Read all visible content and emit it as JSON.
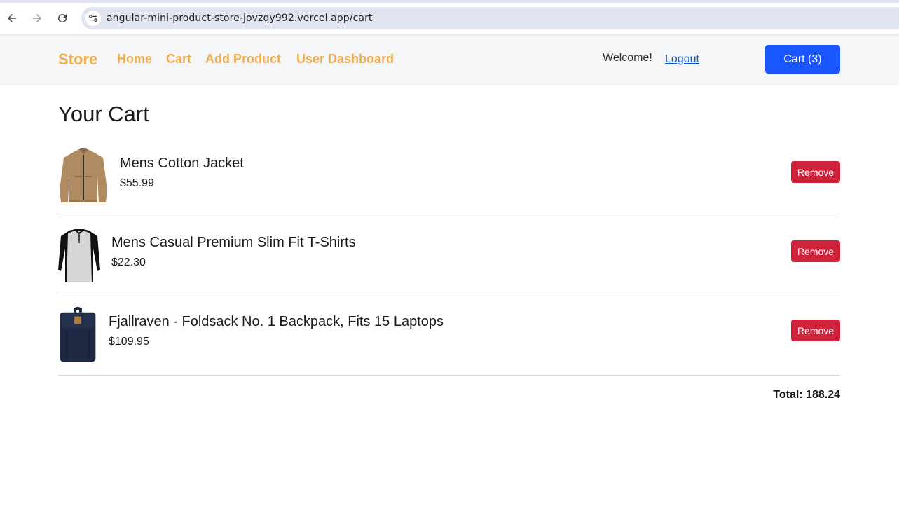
{
  "browser": {
    "url": "angular-mini-product-store-jovzqy992.vercel.app/cart",
    "icons": [
      "back-arrow-icon",
      "forward-arrow-icon",
      "reload-icon",
      "site-settings-icon"
    ]
  },
  "header": {
    "brand": "Store",
    "nav": [
      {
        "label": "Home"
      },
      {
        "label": "Cart"
      },
      {
        "label": "Add Product"
      },
      {
        "label": "User Dashboard"
      }
    ],
    "welcome": "Welcome!",
    "logout": "Logout",
    "cart_button": "Cart (3)"
  },
  "main": {
    "title": "Your Cart",
    "items": [
      {
        "name": "Mens Cotton Jacket",
        "price": "$55.99",
        "image": "jacket-image",
        "remove": "Remove"
      },
      {
        "name": "Mens Casual Premium Slim Fit T-Shirts",
        "price": "$22.30",
        "image": "tshirt-image",
        "remove": "Remove"
      },
      {
        "name": "Fjallraven - Foldsack No. 1 Backpack, Fits 15 Laptops",
        "price": "$109.95",
        "image": "backpack-image",
        "remove": "Remove"
      }
    ],
    "total_label": "Total: 188.24"
  },
  "colors": {
    "brand": "#f0ad4e",
    "primary": "#1a56ff",
    "danger": "#d0223b",
    "link": "#0b57d0"
  }
}
